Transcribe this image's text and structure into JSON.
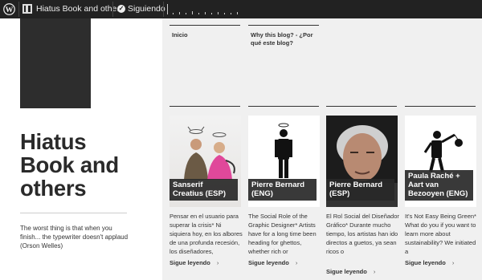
{
  "admin_bar": {
    "site_name": "Hiatus Book and othe...",
    "follow_label": "Siguiendo"
  },
  "header": {
    "title": "Hiatus Book and others",
    "tagline": "The worst thing is that when you finish... the typewriter doesn't applaud (Orson Welles)"
  },
  "nav": [
    {
      "label": "Inicio"
    },
    {
      "label": "Why this blog? - ¿Por qué este blog?"
    }
  ],
  "posts": [
    {
      "title": "Sanserif Creatius (ESP)",
      "excerpt": "Pensar en el usuario para superar la crisis* Ni siquiera hoy, en los albores de una profunda recesión, los diseñadores,",
      "more": "Sigue leyendo"
    },
    {
      "title": "Pierre Bernard (ENG)",
      "excerpt": "The Social Role of the Graphic Designer* Artists have for a long time been heading for ghettos, whether rich or",
      "more": "Sigue leyendo"
    },
    {
      "title": "Pierre Bernard (ESP)",
      "excerpt": "El Rol Social del Diseñador Gráfico* Durante mucho tiempo, los artistas han ido directos a guetos, ya sean ricos o",
      "more": "Sigue leyendo"
    },
    {
      "title": "Paula Raché + Aart van Bezooyen (ENG)",
      "excerpt": "It's Not Easy Being Green* What do you if you want to learn more about sustainability? We initiated a",
      "more": "Sigue leyendo"
    }
  ],
  "icons": {
    "wordpress": "wordpress-logo-icon",
    "site": "site-icon",
    "follow": "checkmark-icon",
    "more_arrow": "›"
  }
}
